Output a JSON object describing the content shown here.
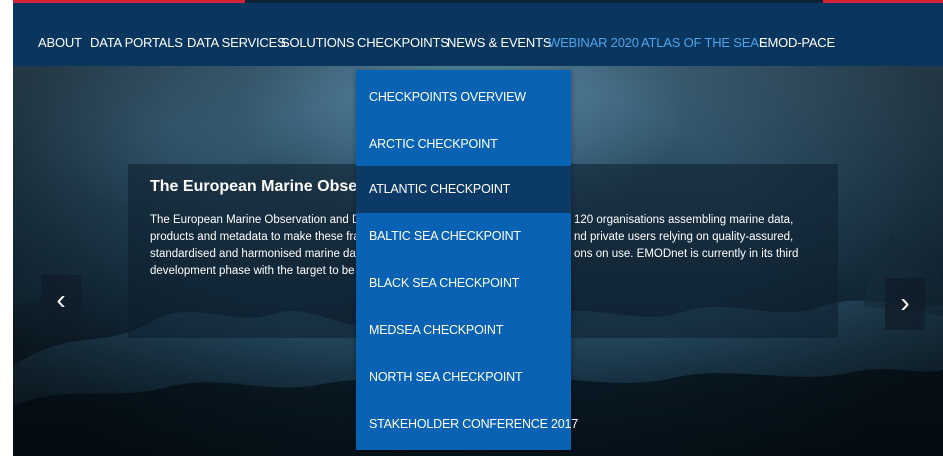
{
  "nav": {
    "items": [
      {
        "label": "ABOUT"
      },
      {
        "label": "DATA PORTALS"
      },
      {
        "label": "DATA SERVICES"
      },
      {
        "label": "SOLUTIONS"
      },
      {
        "label": "CHECKPOINTS"
      },
      {
        "label": "NEWS & EVENTS"
      },
      {
        "label": "WEBINAR 2020"
      },
      {
        "label": "ATLAS OF THE SEAS"
      },
      {
        "label": "EMOD-PACE"
      }
    ]
  },
  "dropdown": {
    "items": [
      {
        "label": "CHECKPOINTS OVERVIEW"
      },
      {
        "label": "ARCTIC CHECKPOINT"
      },
      {
        "label": "ATLANTIC CHECKPOINT"
      },
      {
        "label": "BALTIC SEA CHECKPOINT"
      },
      {
        "label": "BLACK SEA CHECKPOINT"
      },
      {
        "label": "MEDSEA CHECKPOINT"
      },
      {
        "label": "NORTH SEA CHECKPOINT"
      },
      {
        "label": "STAKEHOLDER CONFERENCE 2017"
      }
    ],
    "active_item": "ATLANTIC CHECKPOINT"
  },
  "hero": {
    "title": "The European Marine Observatior",
    "text_lines": [
      "The European Marine Observation and Dat",
      "products and metadata to make these frag",
      "standardised and harmonised marine data",
      "development phase with the target to be fu"
    ],
    "text_lines_right": [
      "120 organisations assembling marine data,",
      "nd private users relying on quality-assured,",
      "ons on use. EMODnet is currently in its third"
    ],
    "prev_arrow": "‹",
    "next_arrow": "›"
  },
  "colors": {
    "navbar": "#08365f",
    "dropdown": "#0762b4",
    "dropdown_active": "#0b3a66",
    "nav_highlight": "#4fa3ea",
    "accent": "#d7203a"
  }
}
